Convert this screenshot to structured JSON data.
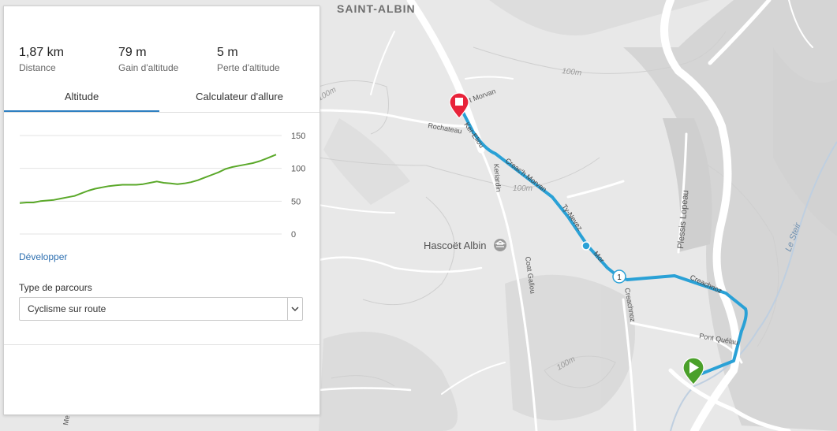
{
  "stats": [
    {
      "value": "1,87 km",
      "label": "Distance"
    },
    {
      "value": "79 m",
      "label": "Gain d'altitude"
    },
    {
      "value": "5 m",
      "label": "Perte d'altitude"
    }
  ],
  "tabs": [
    {
      "label": "Altitude",
      "active": true
    },
    {
      "label": "Calculateur d'allure",
      "active": false
    }
  ],
  "elevation_chart": {
    "y_ticks": [
      "150",
      "100",
      "50",
      "0"
    ],
    "ylim": [
      0,
      150
    ],
    "line_color": "#5aa829",
    "distance_km": [
      0,
      0.05,
      0.1,
      0.15,
      0.2,
      0.25,
      0.3,
      0.35,
      0.4,
      0.45,
      0.5,
      0.55,
      0.6,
      0.65,
      0.7,
      0.75,
      0.8,
      0.85,
      0.9,
      0.95,
      1.0,
      1.05,
      1.1,
      1.15,
      1.2,
      1.25,
      1.3,
      1.35,
      1.4,
      1.45,
      1.5,
      1.55,
      1.6,
      1.65,
      1.7,
      1.75,
      1.8,
      1.87
    ],
    "altitude_m": [
      47,
      48,
      48,
      50,
      51,
      52,
      54,
      56,
      58,
      62,
      66,
      69,
      71,
      73,
      74,
      75,
      75,
      75,
      76,
      78,
      80,
      78,
      77,
      76,
      77,
      79,
      82,
      86,
      90,
      94,
      99,
      102,
      104,
      106,
      108,
      111,
      115,
      121
    ]
  },
  "expand_link": "Développer",
  "route_type": {
    "label": "Type de parcours",
    "value": "Cyclisme sur route"
  },
  "map": {
    "route_color": "#2aa1d6",
    "start_color": "#4aa02a",
    "end_color": "#e8233a",
    "labels": {
      "village": "SAINT-ALBIN",
      "place": "Hascoët Albin",
      "contour_100": "100m",
      "rochateau": "Rochateau",
      "morvan": "t Morvan",
      "ker_eliou": "Ker-Eliou",
      "creach_morvan": "Creac'h Morvan",
      "ty_nevez": "Ty-Nevez",
      "mor": "Mor",
      "keriardin": "Keriardin",
      "coat_gallou": "Coat Gallou",
      "creachnoz": "Creachnoz",
      "creachnoz2": "Creachnoz",
      "pont_quelau": "Pont Quélau",
      "plessis": "Plessis Lopeau",
      "le_steir": "Le Steir",
      "meil": "Meil",
      "km_marker": "1"
    }
  }
}
